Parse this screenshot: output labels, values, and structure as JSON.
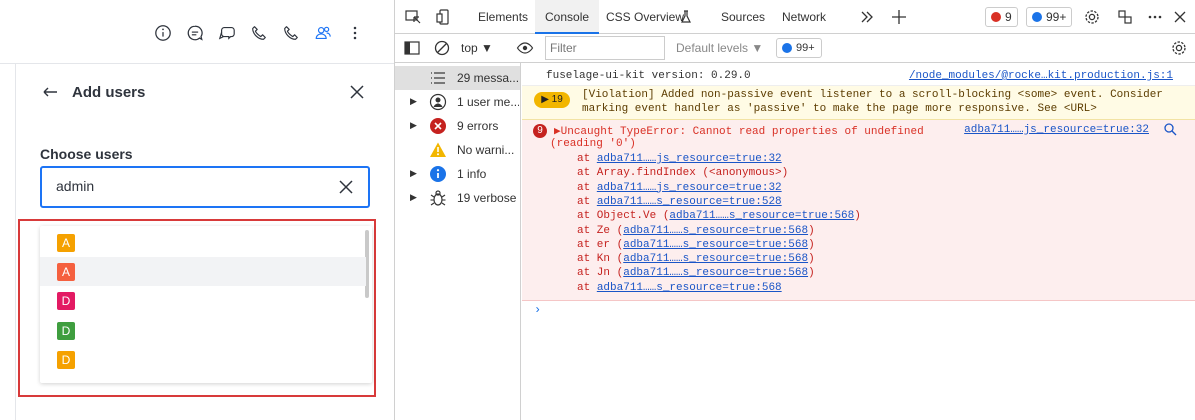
{
  "app": {
    "panel_title": "Add users",
    "choose_label": "Choose users",
    "search_value": "admin",
    "options": [
      {
        "letter": "A",
        "color": "#f5a100"
      },
      {
        "letter": "A",
        "color": "#f5603f"
      },
      {
        "letter": "D",
        "color": "#e31a63"
      },
      {
        "letter": "D",
        "color": "#3f9e3f"
      },
      {
        "letter": "D",
        "color": "#f5a100"
      }
    ]
  },
  "devtools": {
    "tabs": [
      "Elements",
      "Console",
      "CSS Overview",
      "Sources",
      "Network"
    ],
    "error_count": "9",
    "message_count": "99+",
    "context": "top",
    "filter_placeholder": "Filter",
    "levels": "Default levels",
    "issues_count": "99+",
    "sidebar": [
      {
        "label": "29 messa...",
        "icon": "list-icon"
      },
      {
        "label": "1 user me...",
        "icon": "user-icon"
      },
      {
        "label": "9 errors",
        "icon": "error-icon"
      },
      {
        "label": "No warni...",
        "icon": "warning-icon"
      },
      {
        "label": "1 info",
        "icon": "info-icon"
      },
      {
        "label": "19 verbose",
        "icon": "bug-icon"
      }
    ],
    "console": {
      "info_text": "fuselage-ui-kit version: 0.29.0",
      "info_source": "/node_modules/@rocke…kit.production.js:1",
      "warn_count": "19",
      "warn_line1": "[Violation] Added non-passive event listener to a scroll-blocking <some> event. Consider",
      "warn_line2": "marking event handler as 'passive' to make the page more responsive. See <URL>",
      "err_count": "9",
      "err_line1": "▶Uncaught TypeError: Cannot read properties of undefined",
      "err_line2": "(reading '0')",
      "err_source": "adba711……js_resource=true:32",
      "stack": [
        {
          "pre": "at ",
          "link": "adba711……js_resource=true:32",
          "post": ""
        },
        {
          "pre": "at Array.findIndex (<anonymous>)",
          "link": "",
          "post": ""
        },
        {
          "pre": "at ",
          "link": "adba711……js_resource=true:32",
          "post": ""
        },
        {
          "pre": "at ",
          "link": "adba711……s_resource=true:528",
          "post": ""
        },
        {
          "pre": "at Object.Ve (",
          "link": "adba711……s_resource=true:568",
          "post": ")"
        },
        {
          "pre": "at Ze (",
          "link": "adba711……s_resource=true:568",
          "post": ")"
        },
        {
          "pre": "at er (",
          "link": "adba711……s_resource=true:568",
          "post": ")"
        },
        {
          "pre": "at Kn (",
          "link": "adba711……s_resource=true:568",
          "post": ")"
        },
        {
          "pre": "at Jn (",
          "link": "adba711……s_resource=true:568",
          "post": ")"
        },
        {
          "pre": "at ",
          "link": "adba711……s_resource=true:568",
          "post": ""
        }
      ],
      "prompt": "›"
    }
  }
}
